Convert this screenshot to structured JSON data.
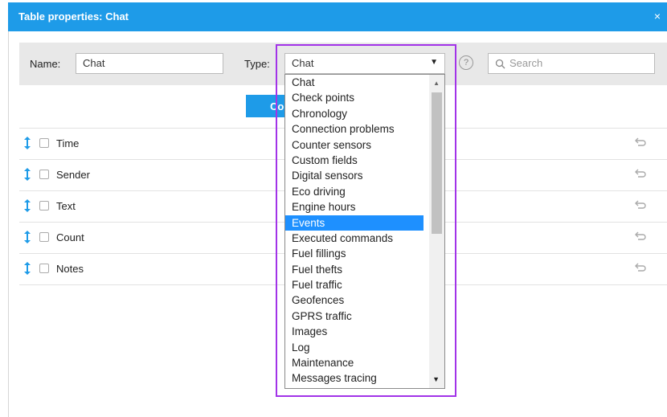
{
  "dialog": {
    "title": "Table properties: Chat",
    "close_icon": "×"
  },
  "toolbar": {
    "name_label": "Name:",
    "name_value": "Chat",
    "type_label": "Type:",
    "type_value": "Chat",
    "help_icon": "?",
    "search_placeholder": "Search"
  },
  "button": {
    "label": "Co"
  },
  "columns": [
    {
      "label": "Time"
    },
    {
      "label": "Sender"
    },
    {
      "label": "Text"
    },
    {
      "label": "Count"
    },
    {
      "label": "Notes"
    }
  ],
  "dropdown": {
    "selected_index": 9,
    "options": [
      "Chat",
      "Check points",
      "Chronology",
      "Connection problems",
      "Counter sensors",
      "Custom fields",
      "Digital sensors",
      "Eco driving",
      "Engine hours",
      "Events",
      "Executed commands",
      "Fuel fillings",
      "Fuel thefts",
      "Fuel traffic",
      "Geofences",
      "GPRS traffic",
      "Images",
      "Log",
      "Maintenance",
      "Messages tracing"
    ]
  },
  "colors": {
    "accent": "#1e9be8",
    "selection": "#1e90ff",
    "highlight_border": "#a233e8"
  }
}
